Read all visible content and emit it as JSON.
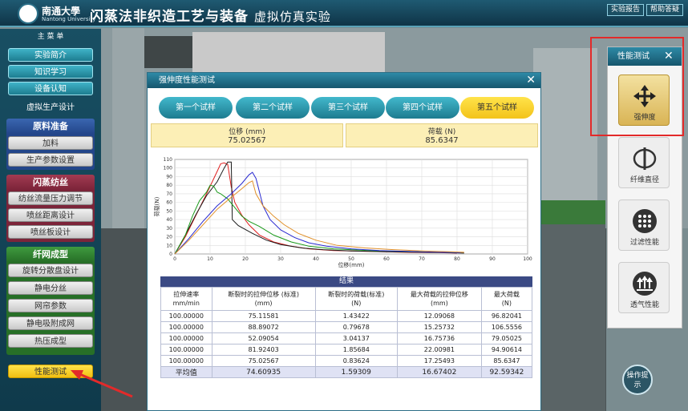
{
  "header": {
    "university": "南通大學",
    "university_en": "Nantong University",
    "title": "闪蒸法非织造工艺与装备",
    "subtitle": "虚拟仿真实验",
    "report_button": "实验报告",
    "help_button": "帮助答疑"
  },
  "sidebar": {
    "main_menu": "主 菜 单",
    "top_items": [
      "实验简介",
      "知识学习",
      "设备认知"
    ],
    "production_heading": "虚拟生产设计",
    "sections": [
      {
        "title": "原料准备",
        "items": [
          "加料",
          "生产参数设置"
        ]
      },
      {
        "title": "闪蒸纺丝",
        "items": [
          "纺丝流量压力调节",
          "喷丝距离设计",
          "喷丝板设计"
        ]
      },
      {
        "title": "纤网成型",
        "items": [
          "旋转分散盘设计",
          "静电分丝",
          "网帘参数",
          "静电吸附成网",
          "热压成型"
        ]
      }
    ],
    "performance_button": "性能测试"
  },
  "modal": {
    "title": "强伸度性能测试",
    "samples": [
      "第一个试样",
      "第二个试样",
      "第三个试样",
      "第四个试样",
      "第五个试样"
    ],
    "selected_sample": 4,
    "displacement_label": "位移 (mm)",
    "displacement_value": "75.02567",
    "load_label": "荷载 (N)",
    "load_value": "85.6347",
    "results": {
      "title": "结果",
      "headers": [
        "拉伸速率\nmm/min",
        "断裂时的拉伸位移 (标准)\n(mm)",
        "断裂时的荷载(标准)\n(N)",
        "最大荷载的拉伸位移\n(mm)",
        "最大荷载\n(N)"
      ],
      "rows": [
        [
          "100.00000",
          "75.11581",
          "1.43422",
          "12.09068",
          "96.82041"
        ],
        [
          "100.00000",
          "88.89072",
          "0.79678",
          "15.25732",
          "106.5556"
        ],
        [
          "100.00000",
          "52.09054",
          "3.04137",
          "16.75736",
          "79.05025"
        ],
        [
          "100.00000",
          "81.92403",
          "1.85684",
          "22.00981",
          "94.90614"
        ],
        [
          "100.00000",
          "75.02567",
          "0.83624",
          "17.25493",
          "85.6347"
        ]
      ],
      "average": [
        "平均值",
        "74.60935",
        "1.59309",
        "16.67402",
        "92.59342"
      ]
    }
  },
  "chart_data": {
    "type": "line",
    "xlabel": "位移(mm)",
    "ylabel": "荷载(N)",
    "xlim": [
      0,
      100
    ],
    "ylim": [
      0,
      110
    ],
    "xticks": [
      0,
      10,
      20,
      30,
      40,
      50,
      60,
      70,
      80,
      90,
      100
    ],
    "yticks": [
      0,
      10,
      20,
      30,
      40,
      50,
      60,
      70,
      80,
      90,
      100,
      110
    ],
    "grid": true,
    "series": [
      {
        "color": "#e02020",
        "points": [
          [
            0,
            0
          ],
          [
            3,
            20
          ],
          [
            6,
            45
          ],
          [
            9,
            70
          ],
          [
            12,
            96
          ],
          [
            13,
            105
          ],
          [
            14,
            106
          ],
          [
            15,
            104
          ],
          [
            16,
            78
          ],
          [
            17,
            60
          ],
          [
            19,
            45
          ],
          [
            21,
            34
          ],
          [
            24,
            22
          ],
          [
            28,
            14
          ],
          [
            33,
            9
          ],
          [
            38,
            6
          ],
          [
            45,
            4
          ],
          [
            55,
            3
          ],
          [
            65,
            2
          ],
          [
            75,
            1.5
          ],
          [
            80,
            1
          ]
        ]
      },
      {
        "color": "#1a1a1a",
        "points": [
          [
            0,
            0
          ],
          [
            3,
            22
          ],
          [
            6,
            46
          ],
          [
            9,
            68
          ],
          [
            12,
            84
          ],
          [
            14,
            100
          ],
          [
            15,
            107
          ],
          [
            16,
            107
          ],
          [
            16.3,
            40
          ],
          [
            18,
            33
          ],
          [
            22,
            24
          ],
          [
            26,
            16
          ],
          [
            30,
            11
          ],
          [
            36,
            7
          ],
          [
            42,
            5
          ],
          [
            50,
            3.5
          ],
          [
            60,
            2.5
          ],
          [
            70,
            2
          ],
          [
            77,
            1.5
          ],
          [
            82,
            1
          ]
        ]
      },
      {
        "color": "#1a9a1a",
        "points": [
          [
            0,
            0
          ],
          [
            3,
            22
          ],
          [
            5,
            44
          ],
          [
            7,
            62
          ],
          [
            9,
            72
          ],
          [
            10,
            80
          ],
          [
            11,
            79
          ],
          [
            12,
            72
          ],
          [
            13,
            70
          ],
          [
            15,
            64
          ],
          [
            17,
            54
          ],
          [
            19,
            44
          ],
          [
            21,
            38
          ],
          [
            24,
            32
          ],
          [
            28,
            22
          ],
          [
            33,
            14
          ],
          [
            38,
            9
          ],
          [
            45,
            6
          ],
          [
            55,
            4
          ],
          [
            65,
            3
          ],
          [
            75,
            2
          ],
          [
            80,
            1.5
          ]
        ]
      },
      {
        "color": "#2a2ad0",
        "points": [
          [
            0,
            0
          ],
          [
            4,
            18
          ],
          [
            8,
            38
          ],
          [
            12,
            56
          ],
          [
            16,
            70
          ],
          [
            19,
            82
          ],
          [
            21,
            92
          ],
          [
            22,
            95
          ],
          [
            23,
            88
          ],
          [
            25,
            56
          ],
          [
            27,
            40
          ],
          [
            30,
            28
          ],
          [
            34,
            19
          ],
          [
            38,
            13
          ],
          [
            43,
            9
          ],
          [
            50,
            6
          ],
          [
            58,
            4
          ],
          [
            66,
            3
          ],
          [
            75,
            2
          ],
          [
            81,
            1.5
          ]
        ]
      },
      {
        "color": "#e0902a",
        "points": [
          [
            0,
            0
          ],
          [
            4,
            16
          ],
          [
            8,
            34
          ],
          [
            12,
            52
          ],
          [
            16,
            66
          ],
          [
            19,
            76
          ],
          [
            21,
            83
          ],
          [
            22,
            85
          ],
          [
            23,
            70
          ],
          [
            25,
            56
          ],
          [
            28,
            44
          ],
          [
            31,
            34
          ],
          [
            35,
            24
          ],
          [
            40,
            16
          ],
          [
            46,
            10
          ],
          [
            54,
            7
          ],
          [
            62,
            5
          ],
          [
            70,
            3.5
          ],
          [
            78,
            2.5
          ],
          [
            82,
            2
          ]
        ]
      }
    ]
  },
  "right_panel": {
    "title": "性能测试",
    "items": [
      {
        "label": "强伸度",
        "icon": "move-arrows-icon",
        "active": true
      },
      {
        "label": "纤维直径",
        "icon": "fiber-circle-icon",
        "active": false
      },
      {
        "label": "过滤性能",
        "icon": "filter-dots-icon",
        "active": false
      },
      {
        "label": "透气性能",
        "icon": "air-arrows-icon",
        "active": false
      }
    ]
  },
  "op_button": "操作提示",
  "colors": {
    "accent_teal": "#1d7d90",
    "selected_yellow": "#f3c31a",
    "highlight_red": "#e32a2a",
    "table_header": "#3b4a84"
  }
}
